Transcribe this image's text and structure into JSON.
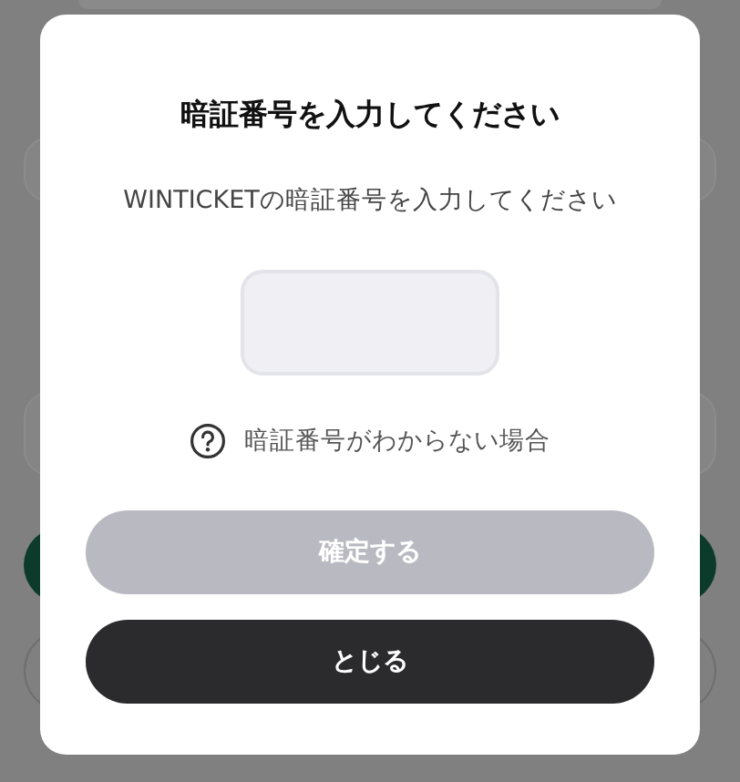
{
  "dialog": {
    "title": "暗証番号を入力してください",
    "message": "WINTICKETの暗証番号を入力してください",
    "help_link": {
      "label": "暗証番号がわからない場合"
    },
    "buttons": [
      {
        "label": "確定する",
        "kind": "primary",
        "disabled": true
      },
      {
        "label": "とじる",
        "kind": "secondary",
        "disabled": false
      }
    ]
  }
}
